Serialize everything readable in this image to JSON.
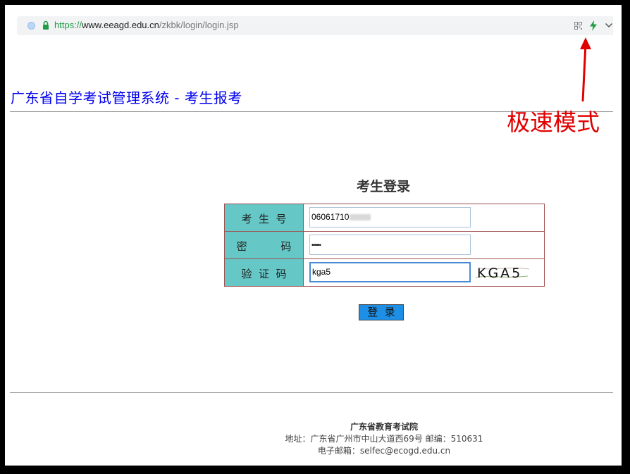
{
  "browser": {
    "url_protocol": "https://",
    "url_host": "www.eeagd.edu.cn",
    "url_path": "/zkbk/login/login.jsp",
    "icons": [
      "site-icon",
      "lock-icon",
      "qr-code-icon",
      "lightning-icon",
      "chevron-down-icon"
    ]
  },
  "page": {
    "title": "广东省自学考试管理系统 - 考生报考"
  },
  "annotation": {
    "text": "极速模式",
    "color": "#e00000"
  },
  "login": {
    "heading": "考生登录",
    "fields": [
      {
        "label": "考  生  号",
        "value": "06061710"
      },
      {
        "label": "密          码",
        "value": "••••••"
      },
      {
        "label": "验  证  码",
        "value": "kga5"
      }
    ],
    "captcha_text": "KGA5",
    "button_label": "登  录"
  },
  "footer": {
    "org": "广东省教育考试院",
    "address": "地址：广东省广州市中山大道西69号 邮编：510631",
    "email": "电子邮箱：selfec@ecogd.edu.cn"
  },
  "colors": {
    "title": "#0000ee",
    "label_bg": "#66c7c7",
    "table_border": "#a05050",
    "button_bg": "#1e8fe6"
  }
}
